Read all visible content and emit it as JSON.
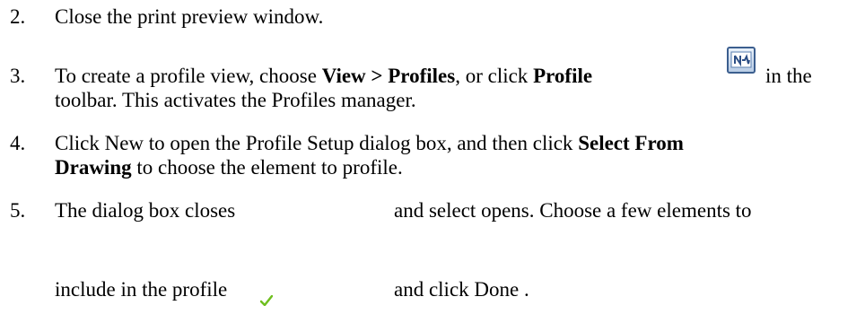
{
  "steps": [
    {
      "number": "2.",
      "text": "Close the print preview window."
    },
    {
      "number": "3.",
      "line1_part1": "To create a profile view, choose ",
      "line1_bold1": "View > Profiles",
      "line1_part2": ", or click ",
      "line1_bold2": "Profile",
      "line1_part3": "in the",
      "line2": "toolbar. This activates the Profiles manager."
    },
    {
      "number": "4.",
      "line1_part1": "Click New to open the Profile Setup dialog box, and then click ",
      "line1_bold": "Select From",
      "line2_bold": "Drawing",
      "line2_part": " to choose the element to profile."
    },
    {
      "number": "5.",
      "line1_part1": "The dialog box closes",
      "line1_part2": "and select opens. Choose a few elements to",
      "line2_part1": "include in the profile",
      "line2_part2": "and click Done ."
    }
  ],
  "icons": {
    "profile": "profile-view-icon",
    "done": "green-checkmark-icon"
  },
  "colors": {
    "text": "#000000",
    "icon_border": "#3c5f8f",
    "check": "#6fbf1f"
  }
}
